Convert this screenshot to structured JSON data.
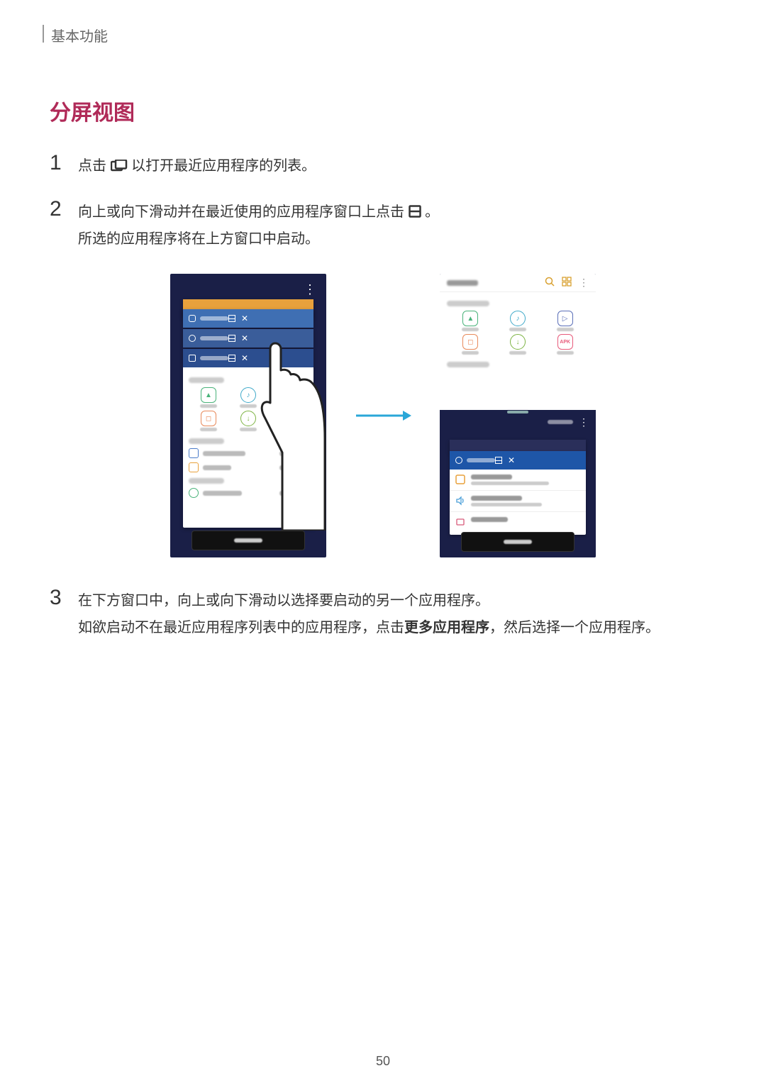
{
  "header": "基本功能",
  "title": "分屏视图",
  "steps": {
    "s1": {
      "num": "1",
      "pre": "点击 ",
      "post": " 以打开最近应用程序的列表。"
    },
    "s2": {
      "num": "2",
      "pre": "向上或向下滑动并在最近使用的应用程序窗口上点击 ",
      "post": "。",
      "line2": "所选的应用程序将在上方窗口中启动。"
    },
    "s3": {
      "num": "3",
      "line1": "在下方窗口中，向上或向下滑动以选择要启动的另一个应用程序。",
      "line2a": "如欲启动不在最近应用程序列表中的应用程序，点击",
      "bold": "更多应用程序",
      "line2b": "，然后选择一个应用程序。"
    }
  },
  "apk_label": "APK",
  "page_number": "50"
}
